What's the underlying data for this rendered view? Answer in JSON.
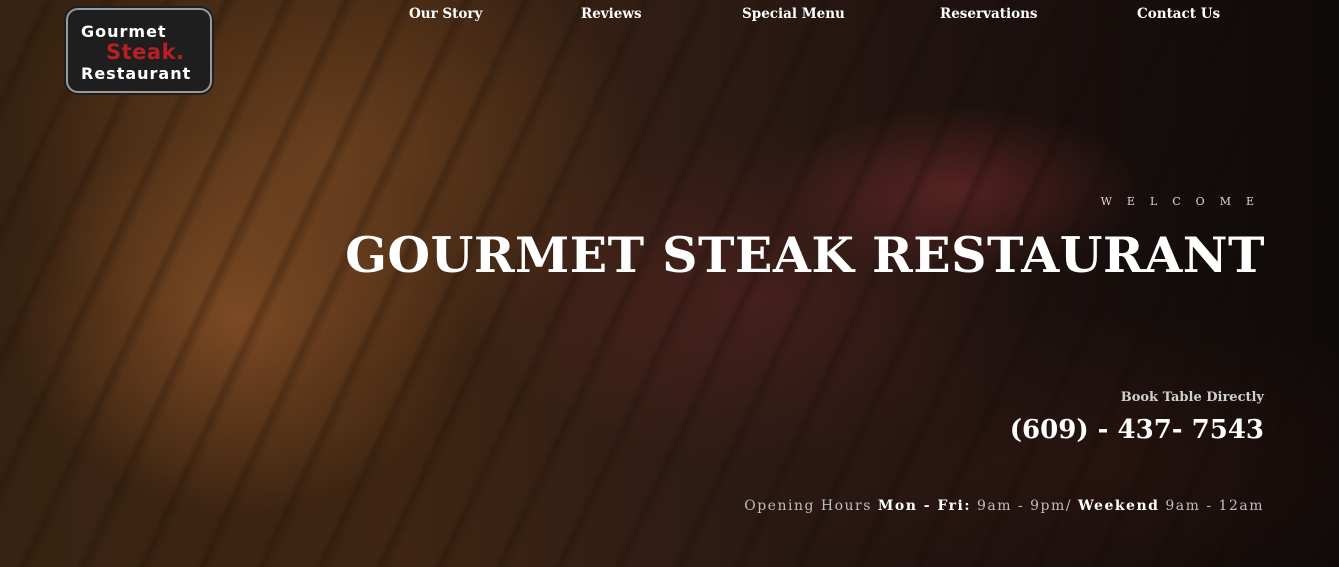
{
  "logo": {
    "line1": "Gourmet",
    "line2": "Steak.",
    "line3": "Restaurant"
  },
  "nav": {
    "items": [
      {
        "label": "Our Story"
      },
      {
        "label": "Reviews"
      },
      {
        "label": "Special Menu"
      },
      {
        "label": "Reservations"
      },
      {
        "label": "Contact Us"
      }
    ]
  },
  "hero": {
    "eyebrow": "WELCOME",
    "title": "GOURMET STEAK RESTAURANT",
    "book_label": "Book Table Directly",
    "phone": "(609) - 437- 7543",
    "hours": {
      "label": "Opening Hours",
      "weekdays_label": "Mon - Fri:",
      "weekdays_time": "9am - 9pm/",
      "weekend_label": "Weekend",
      "weekend_time": "9am - 12am"
    }
  },
  "colors": {
    "logo_accent": "#b81e24",
    "logo_background": "#1e1e1e",
    "text": "#ffffff"
  }
}
